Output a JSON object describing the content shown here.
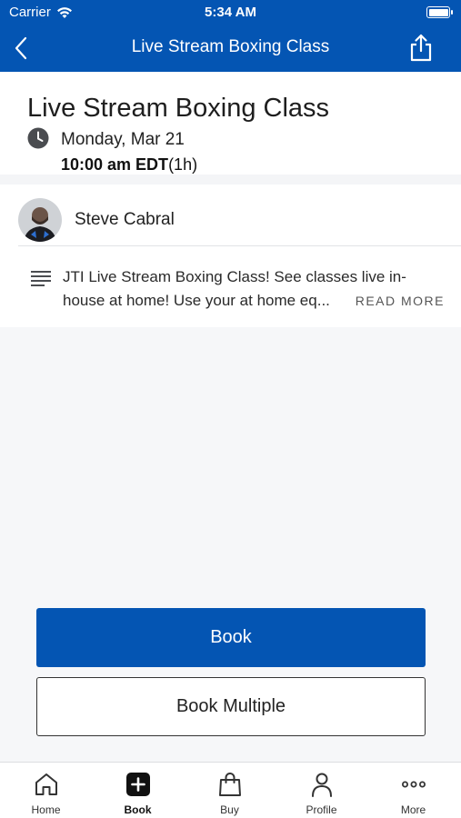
{
  "status_bar": {
    "carrier": "Carrier",
    "time": "5:34 AM"
  },
  "nav": {
    "title": "Live Stream Boxing Class",
    "back_icon": "chevron-left-icon",
    "share_icon": "share-icon"
  },
  "class": {
    "title": "Live Stream Boxing Class",
    "date": "Monday, Mar 21",
    "time": "10:00 am EDT",
    "duration": "(1h)"
  },
  "instructor": {
    "name": "Steve Cabral"
  },
  "description": {
    "line1": "JTI Live Stream Boxing Class! See classes live in-",
    "line2": "house at home! Use your at home eq...",
    "read_more": "READ MORE"
  },
  "actions": {
    "book": "Book",
    "book_multiple": "Book Multiple"
  },
  "tabs": [
    {
      "label": "Home",
      "icon": "home-icon"
    },
    {
      "label": "Book",
      "icon": "plus-square-icon",
      "active": true
    },
    {
      "label": "Buy",
      "icon": "shopping-bag-icon"
    },
    {
      "label": "Profile",
      "icon": "person-icon"
    },
    {
      "label": "More",
      "icon": "more-dots-icon"
    }
  ],
  "colors": {
    "brand": "#0455b3",
    "background": "#f6f7f9"
  }
}
